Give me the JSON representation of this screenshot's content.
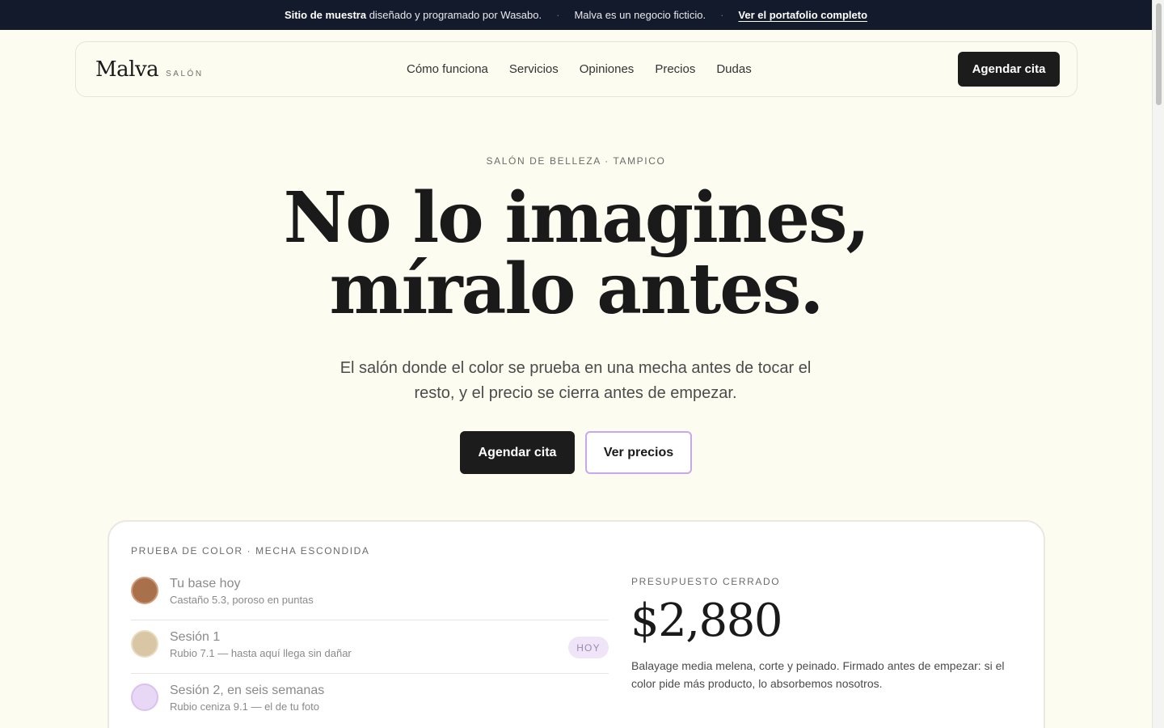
{
  "topbar": {
    "sample_strong": "Sitio de muestra",
    "sample_rest": " diseñado y programado por Wasabo.",
    "separator": "·",
    "fictional": "Malva es un negocio ficticio.",
    "portfolio_link": "Ver el portafolio completo"
  },
  "nav": {
    "logo": "Malva",
    "logo_sub": "SALÓN",
    "links": [
      "Cómo funciona",
      "Servicios",
      "Opiniones",
      "Precios",
      "Dudas"
    ],
    "cta": "Agendar cita"
  },
  "hero": {
    "eyebrow": "SALÓN DE BELLEZA · TAMPICO",
    "title_line1": "No lo imagines,",
    "title_line2": "míralo antes.",
    "subtitle": "El salón donde el color se prueba en una mecha antes de tocar el resto, y el precio se cierra antes de empezar.",
    "primary_button": "Agendar cita",
    "secondary_button": "Ver precios"
  },
  "card": {
    "eyebrow": "PRUEBA DE COLOR · MECHA ESCONDIDA",
    "steps": [
      {
        "title": "Tu base hoy",
        "desc": "Castaño 5.3, poroso en puntas",
        "color": "#a8704b"
      },
      {
        "title": "Sesión 1",
        "desc": "Rubio 7.1 — hasta aquí llega sin dañar",
        "badge": "HOY",
        "color": "#d9c6a4"
      },
      {
        "title": "Sesión 2, en seis semanas",
        "desc": "Rubio ceniza 9.1 — el de tu foto",
        "color": "#e8d8f6"
      }
    ],
    "price_eyebrow": "PRESUPUESTO CERRADO",
    "price": "$2,880",
    "price_desc": "Balayage media melena, corte y peinado. Firmado antes de empezar: si el color pide más producto, lo absorbemos nosotros."
  },
  "colors": {
    "background": "#fdfcf0",
    "topbar": "#131a2b",
    "primary": "#1c1c1c",
    "accent_border": "#c8a8ec",
    "badge_bg": "#efe4f8"
  }
}
